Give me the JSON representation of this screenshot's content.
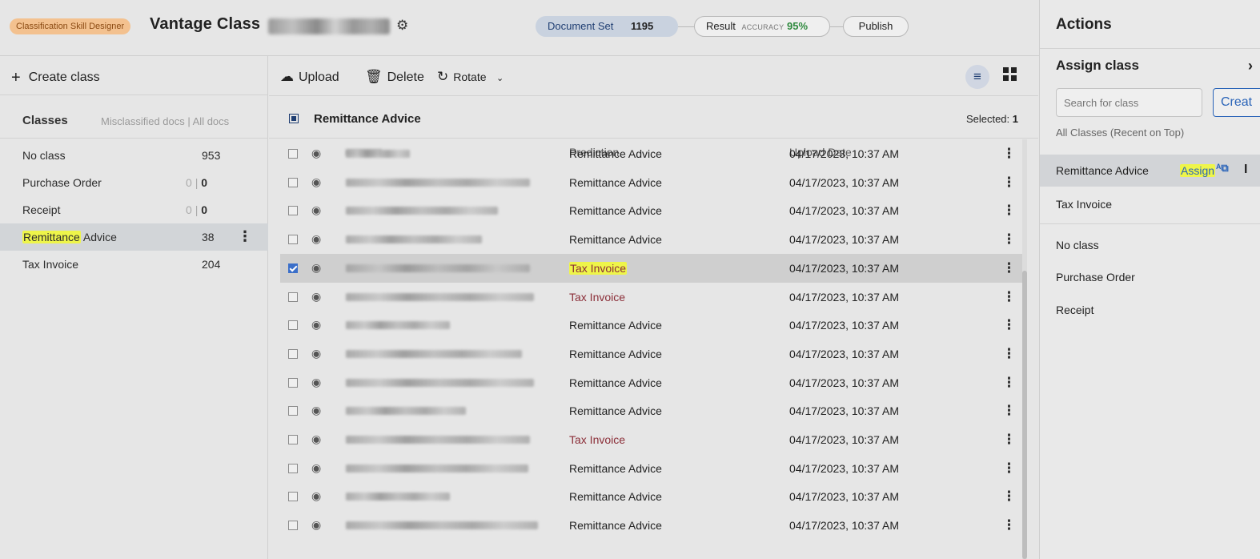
{
  "header": {
    "skill_badge": "Classification Skill Designer",
    "app_title": "Vantage Class",
    "document_set_label": "Document Set",
    "document_set_count": "1195",
    "result_label": "Result",
    "accuracy_label": "ACCURACY",
    "accuracy_value": "95%",
    "publish_label": "Publish"
  },
  "left_panel": {
    "create_class_label": "Create class",
    "classes_heading": "Classes",
    "classes_subheading": "Misclassified docs | All docs",
    "classes": [
      {
        "name": "No class",
        "count": "953"
      },
      {
        "name": "Purchase Order",
        "misclassified": "0",
        "sep": "|",
        "count": "0"
      },
      {
        "name": "Receipt",
        "misclassified": "0",
        "sep": "|",
        "count": "0"
      },
      {
        "name_highlight": "Remittance",
        "name_rest": " Advice",
        "count": "38"
      },
      {
        "name": "Tax Invoice",
        "count": "204"
      }
    ]
  },
  "toolbar": {
    "upload_label": "Upload",
    "delete_label": "Delete",
    "rotate_label": "Rotate"
  },
  "group": {
    "title": "Remittance Advice",
    "selected_label": "Selected:",
    "selected_count": "1"
  },
  "table": {
    "columns": {
      "prediction": "Prediction",
      "upload_date": "Upload Date"
    },
    "rows": [
      {
        "prediction": "Remittance Advice",
        "date": "04/17/2023, 10:37 AM"
      },
      {
        "prediction": "Remittance Advice",
        "date": "04/17/2023, 10:37 AM"
      },
      {
        "prediction": "Remittance Advice",
        "date": "04/17/2023, 10:37 AM"
      },
      {
        "prediction": "Remittance Advice",
        "date": "04/17/2023, 10:37 AM"
      },
      {
        "prediction": "Tax Invoice",
        "date": "04/17/2023, 10:37 AM"
      },
      {
        "prediction": "Tax Invoice",
        "date": "04/17/2023, 10:37 AM"
      },
      {
        "prediction": "Remittance Advice",
        "date": "04/17/2023, 10:37 AM"
      },
      {
        "prediction": "Remittance Advice",
        "date": "04/17/2023, 10:37 AM"
      },
      {
        "prediction": "Remittance Advice",
        "date": "04/17/2023, 10:37 AM"
      },
      {
        "prediction": "Remittance Advice",
        "date": "04/17/2023, 10:37 AM"
      },
      {
        "prediction": "Tax Invoice",
        "date": "04/17/2023, 10:37 AM"
      },
      {
        "prediction": "Remittance Advice",
        "date": "04/17/2023, 10:37 AM"
      },
      {
        "prediction": "Remittance Advice",
        "date": "04/17/2023, 10:37 AM"
      },
      {
        "prediction": "Remittance Advice",
        "date": "04/17/2023, 10:37 AM"
      }
    ]
  },
  "right_panel": {
    "title": "Actions",
    "assign_title": "Assign class",
    "search_placeholder": "Search for class",
    "create_label": "Creat",
    "all_classes_label": "All Classes (Recent on Top)",
    "assign_link": "Assign",
    "recent": [
      {
        "name": "Remittance Advice"
      },
      {
        "name": "Tax Invoice"
      }
    ],
    "others": [
      {
        "name": "No class"
      },
      {
        "name": "Purchase Order"
      },
      {
        "name": "Receipt"
      }
    ]
  },
  "colors": {
    "accent": "#2a64b8",
    "tax_invoice_text": "#8b2e38",
    "highlight": "#eef54a",
    "accuracy": "#2f8a3e"
  }
}
